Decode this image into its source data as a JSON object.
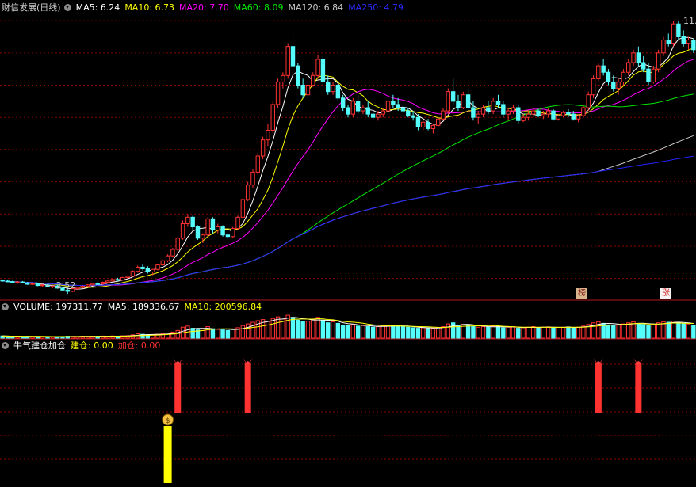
{
  "main_header": {
    "stock_title": "财信发展(日线)",
    "ma5": "MA5: 6.24",
    "ma10": "MA10: 6.73",
    "ma20": "MA20: 7.70",
    "ma60": "MA60: 8.09",
    "ma120": "MA120: 6.84",
    "ma250": "MA250: 4.79"
  },
  "volume_header": {
    "volume": "VOLUME: 197311.77",
    "ma5": "MA5: 189336.67",
    "ma10": "MA10: 200596.84"
  },
  "indicator_header": {
    "name": "牛气建仓加仓",
    "jiancang": "建仓: 0.00",
    "jiacang": "加仓: 0.00"
  },
  "annotations": {
    "high_label": "11.",
    "low_label": "2.52",
    "bang_badge": "榜",
    "zhang_badge": "涨"
  },
  "colors": {
    "up": "#ff3232",
    "down": "#54fcfc",
    "ma5": "#ffffff",
    "ma10": "#ffff00",
    "ma20": "#ff00ff",
    "ma60": "#00e600",
    "ma120": "#c8c8c8",
    "ma250": "#2222ff",
    "grid": "#8b0000",
    "panel_border": "#b0171f"
  },
  "chart_data": {
    "type": "candlestick",
    "title": "财信发展(日线)",
    "y_range": [
      2.5,
      11.2
    ],
    "price_gridlines": [
      3,
      4,
      5,
      6,
      7,
      8,
      9,
      10,
      11
    ],
    "extremes": {
      "high": 11.0,
      "low": 2.52
    },
    "candles": [
      [
        2.95,
        2.97,
        2.9,
        2.92
      ],
      [
        2.92,
        2.95,
        2.88,
        2.9
      ],
      [
        2.9,
        2.93,
        2.85,
        2.87
      ],
      [
        2.87,
        2.91,
        2.84,
        2.89
      ],
      [
        2.89,
        2.92,
        2.85,
        2.86
      ],
      [
        2.86,
        2.89,
        2.8,
        2.82
      ],
      [
        2.82,
        2.86,
        2.79,
        2.84
      ],
      [
        2.84,
        2.87,
        2.76,
        2.78
      ],
      [
        2.78,
        2.82,
        2.74,
        2.8
      ],
      [
        2.8,
        2.83,
        2.72,
        2.74
      ],
      [
        2.74,
        2.79,
        2.7,
        2.77
      ],
      [
        2.77,
        2.8,
        2.68,
        2.7
      ],
      [
        2.7,
        2.75,
        2.62,
        2.64
      ],
      [
        2.64,
        2.68,
        2.52,
        2.6
      ],
      [
        2.6,
        2.7,
        2.58,
        2.68
      ],
      [
        2.68,
        2.74,
        2.65,
        2.72
      ],
      [
        2.72,
        2.78,
        2.7,
        2.76
      ],
      [
        2.76,
        2.82,
        2.73,
        2.8
      ],
      [
        2.8,
        2.86,
        2.78,
        2.84
      ],
      [
        2.84,
        2.88,
        2.8,
        2.83
      ],
      [
        2.83,
        2.9,
        2.81,
        2.88
      ],
      [
        2.88,
        2.94,
        2.85,
        2.92
      ],
      [
        2.92,
        3.0,
        2.9,
        2.97
      ],
      [
        2.97,
        3.02,
        2.93,
        2.95
      ],
      [
        2.95,
        3.05,
        2.94,
        3.03
      ],
      [
        3.03,
        3.1,
        3.0,
        3.07
      ],
      [
        3.07,
        3.25,
        3.05,
        3.22
      ],
      [
        3.22,
        3.4,
        3.18,
        3.35
      ],
      [
        3.35,
        3.45,
        3.25,
        3.3
      ],
      [
        3.3,
        3.38,
        3.15,
        3.2
      ],
      [
        3.2,
        3.3,
        3.1,
        3.28
      ],
      [
        3.28,
        3.45,
        3.25,
        3.42
      ],
      [
        3.42,
        3.6,
        3.38,
        3.55
      ],
      [
        3.55,
        3.75,
        3.5,
        3.7
      ],
      [
        3.7,
        3.95,
        3.65,
        3.9
      ],
      [
        3.9,
        4.3,
        3.85,
        4.25
      ],
      [
        4.25,
        4.8,
        4.2,
        4.7
      ],
      [
        4.7,
        5.0,
        4.6,
        4.9
      ],
      [
        4.9,
        4.95,
        4.5,
        4.6
      ],
      [
        4.6,
        4.65,
        4.2,
        4.25
      ],
      [
        4.25,
        4.4,
        4.1,
        4.35
      ],
      [
        4.35,
        4.9,
        4.3,
        4.85
      ],
      [
        4.85,
        4.9,
        4.4,
        4.5
      ],
      [
        4.5,
        4.7,
        4.4,
        4.6
      ],
      [
        4.6,
        4.65,
        4.3,
        4.35
      ],
      [
        4.35,
        4.4,
        4.2,
        4.3
      ],
      [
        4.3,
        4.6,
        4.25,
        4.55
      ],
      [
        4.55,
        4.95,
        4.5,
        4.9
      ],
      [
        4.9,
        5.5,
        4.85,
        5.45
      ],
      [
        5.45,
        6.0,
        5.4,
        5.9
      ],
      [
        5.9,
        6.4,
        5.8,
        6.3
      ],
      [
        6.3,
        6.9,
        6.2,
        6.8
      ],
      [
        6.8,
        7.4,
        6.7,
        7.3
      ],
      [
        7.3,
        7.8,
        7.1,
        7.6
      ],
      [
        7.6,
        8.5,
        7.5,
        8.4
      ],
      [
        8.4,
        9.2,
        8.3,
        9.1
      ],
      [
        9.1,
        9.4,
        8.9,
        9.3
      ],
      [
        9.3,
        10.3,
        9.2,
        10.2
      ],
      [
        10.2,
        10.7,
        9.5,
        9.6
      ],
      [
        9.6,
        9.7,
        8.9,
        9.0
      ],
      [
        9.0,
        9.2,
        8.6,
        8.7
      ],
      [
        8.7,
        9.1,
        8.6,
        9.0
      ],
      [
        9.0,
        9.4,
        8.95,
        9.3
      ],
      [
        9.3,
        9.95,
        9.2,
        9.8
      ],
      [
        9.8,
        9.9,
        9.0,
        9.1
      ],
      [
        9.1,
        9.3,
        8.7,
        8.8
      ],
      [
        8.8,
        9.1,
        8.7,
        9.0
      ],
      [
        9.0,
        9.1,
        8.5,
        8.6
      ],
      [
        8.6,
        8.7,
        8.2,
        8.3
      ],
      [
        8.3,
        8.4,
        8.0,
        8.1
      ],
      [
        8.1,
        8.6,
        8.0,
        8.5
      ],
      [
        8.5,
        8.7,
        8.1,
        8.2
      ],
      [
        8.2,
        8.4,
        8.1,
        8.3
      ],
      [
        8.3,
        8.5,
        8.0,
        8.1
      ],
      [
        8.1,
        8.2,
        7.9,
        8.0
      ],
      [
        8.0,
        8.2,
        7.9,
        8.1
      ],
      [
        8.1,
        8.3,
        8.0,
        8.2
      ],
      [
        8.2,
        8.6,
        8.1,
        8.5
      ],
      [
        8.5,
        8.7,
        8.3,
        8.4
      ],
      [
        8.4,
        8.6,
        8.2,
        8.3
      ],
      [
        8.3,
        8.45,
        8.1,
        8.2
      ],
      [
        8.2,
        8.3,
        8.0,
        8.05
      ],
      [
        8.05,
        8.2,
        7.9,
        8.0
      ],
      [
        8.0,
        8.1,
        7.6,
        7.7
      ],
      [
        7.7,
        7.9,
        7.6,
        7.85
      ],
      [
        7.85,
        7.95,
        7.6,
        7.65
      ],
      [
        7.65,
        7.8,
        7.5,
        7.75
      ],
      [
        7.75,
        8.0,
        7.7,
        7.95
      ],
      [
        7.95,
        8.3,
        7.9,
        8.2
      ],
      [
        8.2,
        8.9,
        8.1,
        8.8
      ],
      [
        8.8,
        9.2,
        8.4,
        8.5
      ],
      [
        8.5,
        8.7,
        8.2,
        8.3
      ],
      [
        8.3,
        8.8,
        8.25,
        8.7
      ],
      [
        8.7,
        8.9,
        8.2,
        8.3
      ],
      [
        8.3,
        8.5,
        7.9,
        8.0
      ],
      [
        8.0,
        8.2,
        7.8,
        8.1
      ],
      [
        8.1,
        8.4,
        8.0,
        8.3
      ],
      [
        8.3,
        8.5,
        8.1,
        8.2
      ],
      [
        8.2,
        8.6,
        8.1,
        8.5
      ],
      [
        8.5,
        8.7,
        8.3,
        8.4
      ],
      [
        8.4,
        8.5,
        8.0,
        8.1
      ],
      [
        8.1,
        8.3,
        7.9,
        8.2
      ],
      [
        8.2,
        8.4,
        8.1,
        8.3
      ],
      [
        8.3,
        8.4,
        7.8,
        7.9
      ],
      [
        7.9,
        8.1,
        7.85,
        8.0
      ],
      [
        8.0,
        8.2,
        7.9,
        8.1
      ],
      [
        8.1,
        8.3,
        8.0,
        8.2
      ],
      [
        8.2,
        8.25,
        8.0,
        8.05
      ],
      [
        8.05,
        8.2,
        7.95,
        8.1
      ],
      [
        8.1,
        8.3,
        8.0,
        8.2
      ],
      [
        8.2,
        8.25,
        7.9,
        7.95
      ],
      [
        7.95,
        8.1,
        7.9,
        8.05
      ],
      [
        8.05,
        8.2,
        8.0,
        8.15
      ],
      [
        8.15,
        8.25,
        8.0,
        8.1
      ],
      [
        8.1,
        8.2,
        7.9,
        7.95
      ],
      [
        7.95,
        8.1,
        7.85,
        8.05
      ],
      [
        8.05,
        8.4,
        8.0,
        8.3
      ],
      [
        8.3,
        8.8,
        8.2,
        8.7
      ],
      [
        8.7,
        9.3,
        8.6,
        9.2
      ],
      [
        9.2,
        9.7,
        9.1,
        9.6
      ],
      [
        9.6,
        9.8,
        9.3,
        9.4
      ],
      [
        9.4,
        9.5,
        9.0,
        9.1
      ],
      [
        9.1,
        9.3,
        8.8,
        8.9
      ],
      [
        8.9,
        9.2,
        8.7,
        9.1
      ],
      [
        9.1,
        9.5,
        9.0,
        9.4
      ],
      [
        9.4,
        9.8,
        9.3,
        9.7
      ],
      [
        9.7,
        10.1,
        9.6,
        10.0
      ],
      [
        10.0,
        10.2,
        9.6,
        9.7
      ],
      [
        9.7,
        9.9,
        9.4,
        9.5
      ],
      [
        9.5,
        9.7,
        9.0,
        9.1
      ],
      [
        9.1,
        9.6,
        9.05,
        9.5
      ],
      [
        9.5,
        10.1,
        9.4,
        10.0
      ],
      [
        10.0,
        10.5,
        9.9,
        10.4
      ],
      [
        10.4,
        10.6,
        10.2,
        10.3
      ],
      [
        10.3,
        11.0,
        10.2,
        10.9
      ],
      [
        10.9,
        11.0,
        10.4,
        10.5
      ],
      [
        10.5,
        10.7,
        10.2,
        10.3
      ],
      [
        10.3,
        10.5,
        10.1,
        10.4
      ],
      [
        10.4,
        10.45,
        10.0,
        10.1
      ]
    ],
    "ma_lines": [
      {
        "name": "MA5",
        "value": 6.24
      },
      {
        "name": "MA10",
        "value": 6.73
      },
      {
        "name": "MA20",
        "value": 7.7
      },
      {
        "name": "MA60",
        "value": 8.09
      },
      {
        "name": "MA120",
        "value": 6.84
      },
      {
        "name": "MA250",
        "value": 4.79
      }
    ],
    "volume": {
      "last": 197311.77,
      "ma5": 189336.67,
      "ma10": 200596.84,
      "bars": [
        40,
        35,
        30,
        33,
        28,
        31,
        27,
        30,
        29,
        26,
        28,
        25,
        30,
        35,
        32,
        30,
        34,
        31,
        36,
        33,
        38,
        35,
        40,
        37,
        42,
        45,
        60,
        80,
        70,
        65,
        60,
        72,
        85,
        95,
        110,
        140,
        200,
        220,
        180,
        150,
        140,
        210,
        170,
        160,
        150,
        140,
        160,
        190,
        230,
        260,
        290,
        320,
        340,
        310,
        360,
        390,
        350,
        420,
        380,
        330,
        300,
        310,
        340,
        380,
        320,
        280,
        300,
        270,
        240,
        230,
        250,
        220,
        230,
        210,
        200,
        210,
        220,
        240,
        230,
        220,
        210,
        200,
        190,
        180,
        190,
        185,
        180,
        190,
        210,
        260,
        280,
        240,
        250,
        230,
        210,
        200,
        210,
        200,
        220,
        210,
        190,
        200,
        210,
        180,
        190,
        200,
        210,
        195,
        200,
        205,
        190,
        195,
        200,
        205,
        190,
        200,
        220,
        250,
        280,
        300,
        270,
        240,
        230,
        240,
        260,
        280,
        300,
        270,
        250,
        230,
        250,
        280,
        300,
        290,
        310,
        280,
        260,
        250,
        240
      ],
      "range_max": 450
    },
    "indicator": {
      "name": "牛气建仓加仓",
      "jiancang": 0.0,
      "jiacang": 0.0,
      "red_signal_indices": [
        35,
        49,
        119,
        127
      ],
      "yellow_signal_indices": [
        33
      ]
    }
  }
}
